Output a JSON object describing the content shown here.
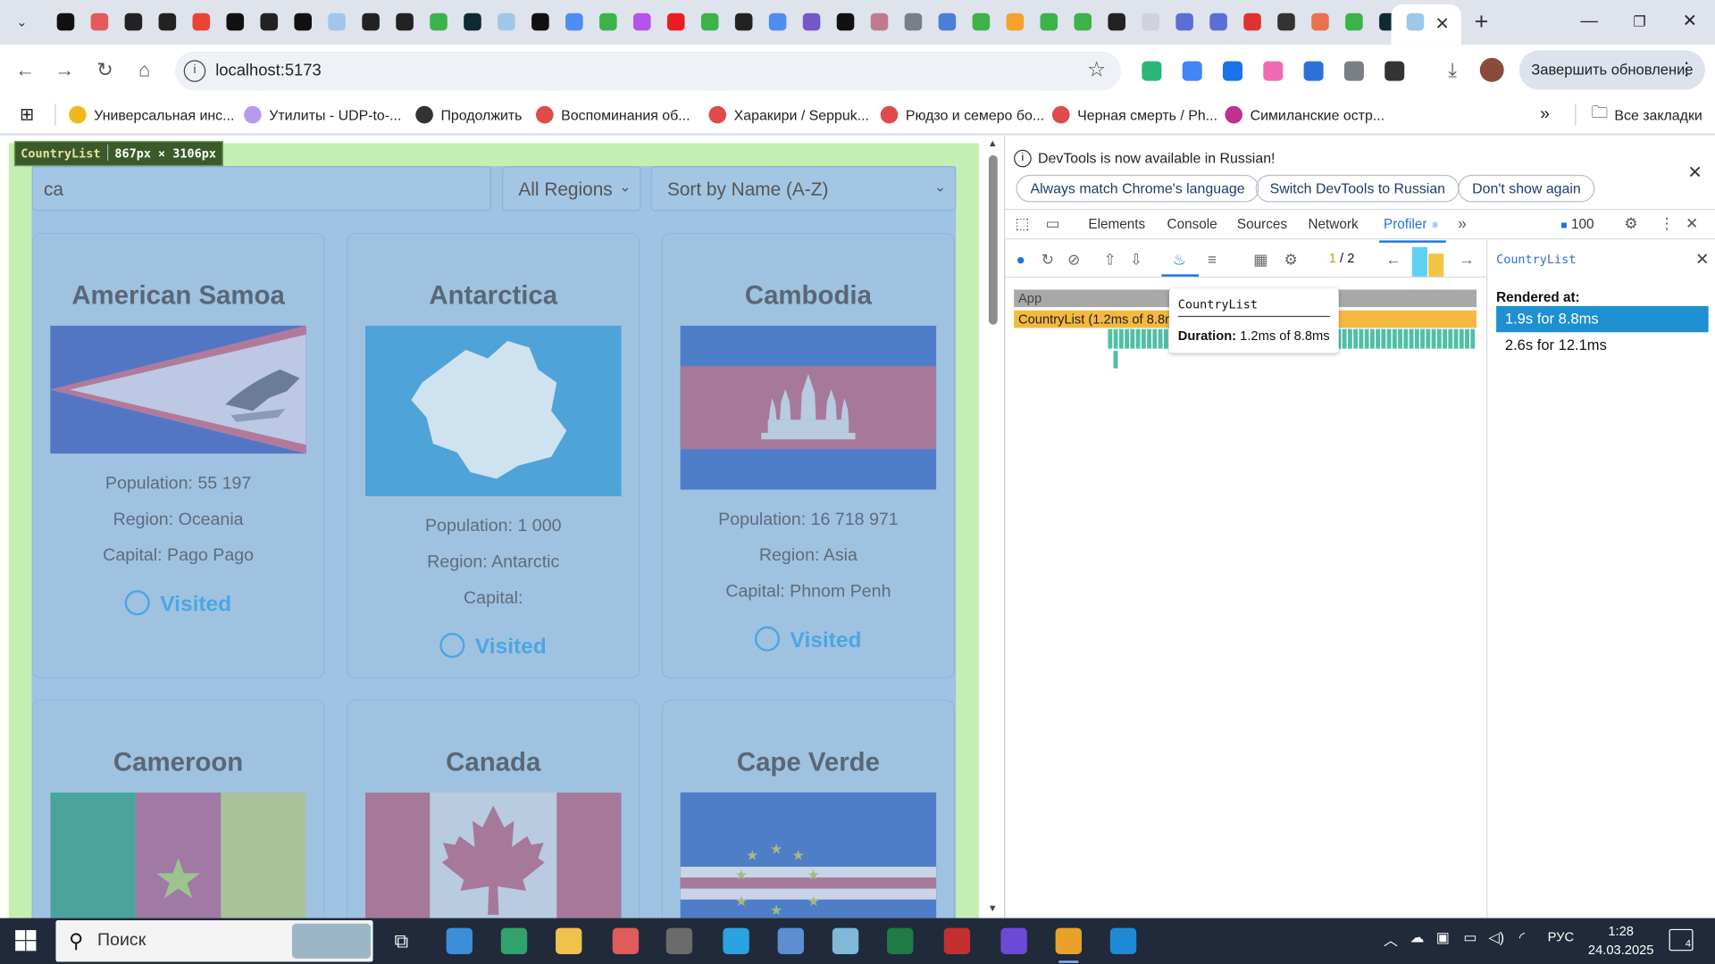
{
  "browser": {
    "tab_favicon_colors": [
      "#111111",
      "#e35b5b",
      "#222222",
      "#222222",
      "#ea4335",
      "#111111",
      "#222222",
      "#111111",
      "#9fc7ea",
      "#222222",
      "#222222",
      "#3bb34a",
      "#0f2a33",
      "#9fc7ea",
      "#111111",
      "#4f8cf3",
      "#3bb34a",
      "#b254ea",
      "#e81c23",
      "#3bb34a",
      "#222222",
      "#4f8cf3",
      "#7458c7",
      "#111111",
      "#c07a8e",
      "#7a7f86",
      "#4b7fd3",
      "#3bb34a",
      "#f4a22a",
      "#3bb34a",
      "#3bb34a",
      "#222222",
      "#d0d3d8",
      "#5a6fd6",
      "#5a6fd6",
      "#e03131",
      "#333333",
      "#e9724c",
      "#3bb34a",
      "#0f2a33",
      "#c58ce6"
    ],
    "active_tab_favicon_color": "#9fc7ea",
    "url": "localhost:5173",
    "update_button": "Завершить обновление",
    "extension_colors": [
      "#2bb673",
      "#4285f4",
      "#1a73e8",
      "#f06bb2",
      "#2b72d8",
      "#7a7f86",
      "#333333"
    ],
    "bookmarks": [
      {
        "label": "Универсальная инс...",
        "color": "#f0b81a"
      },
      {
        "label": "Утилиты - UDP-to-...",
        "color": "#b69be8"
      },
      {
        "label": "Продолжить",
        "color": "#333333"
      },
      {
        "label": "Воспоминания об...",
        "color": "#e04a4a"
      },
      {
        "label": "Харакири / Seppuk...",
        "color": "#e04a4a"
      },
      {
        "label": "Рюдзо и семеро бо...",
        "color": "#e04a4a"
      },
      {
        "label": "Черная смерть / Ph...",
        "color": "#e04a4a"
      },
      {
        "label": "Симиланские остр...",
        "color": "#c0308f"
      }
    ],
    "all_bookmarks": "Все закладки"
  },
  "app": {
    "search_value": "ca",
    "region_select": "All Regions",
    "sort_select": "Sort by Name (A-Z)",
    "visited_label": "Visited",
    "countries": [
      {
        "name": "American Samoa",
        "population": "Population: 55 197",
        "region": "Region: Oceania",
        "capital": "Capital: Pago Pago"
      },
      {
        "name": "Antarctica",
        "population": "Population: 1 000",
        "region": "Region: Antarctic",
        "capital": "Capital:"
      },
      {
        "name": "Cambodia",
        "population": "Population: 16 718 971",
        "region": "Region: Asia",
        "capital": "Capital: Phnom Penh"
      },
      {
        "name": "Cameroon"
      },
      {
        "name": "Canada"
      },
      {
        "name": "Cape Verde"
      }
    ]
  },
  "inspect_badge": {
    "component": "CountryList",
    "size": "867px × 3106px"
  },
  "devtools": {
    "notice": "DevTools is now available in Russian!",
    "notice_buttons": [
      "Always match Chrome's language",
      "Switch DevTools to Russian",
      "Don't show again"
    ],
    "tabs": [
      "Elements",
      "Console",
      "Sources",
      "Network",
      "Profiler"
    ],
    "active_tab": "Profiler",
    "issues_count": "100",
    "commit_current": "1",
    "commit_sep": "/",
    "commit_total": "2",
    "flame_root": "App",
    "flame_component": "CountryList (1.2ms of 8.8ms)",
    "selected_component": "CountryList",
    "rendered_at_label": "Rendered at:",
    "renders": [
      "1.9s for 8.8ms",
      "2.6s for 12.1ms"
    ],
    "tooltip_title": "CountryList",
    "tooltip_duration_label": "Duration:",
    "tooltip_duration_value": "1.2ms of 8.8ms"
  },
  "taskbar": {
    "search_placeholder": "Поиск",
    "app_colors": [
      "#3a8fd8",
      "#2fa36b",
      "#f0c24b",
      "#e05b5b",
      "#6b6b6b",
      "#2aa3e0",
      "#5b8fd0",
      "#7fb8d8",
      "#1e7b45",
      "#c43030",
      "#6b4bd6",
      "#e8a22a",
      "#1e8ad6"
    ],
    "language": "РУС",
    "time": "1:28",
    "date": "24.03.2025",
    "notifications": "4"
  }
}
